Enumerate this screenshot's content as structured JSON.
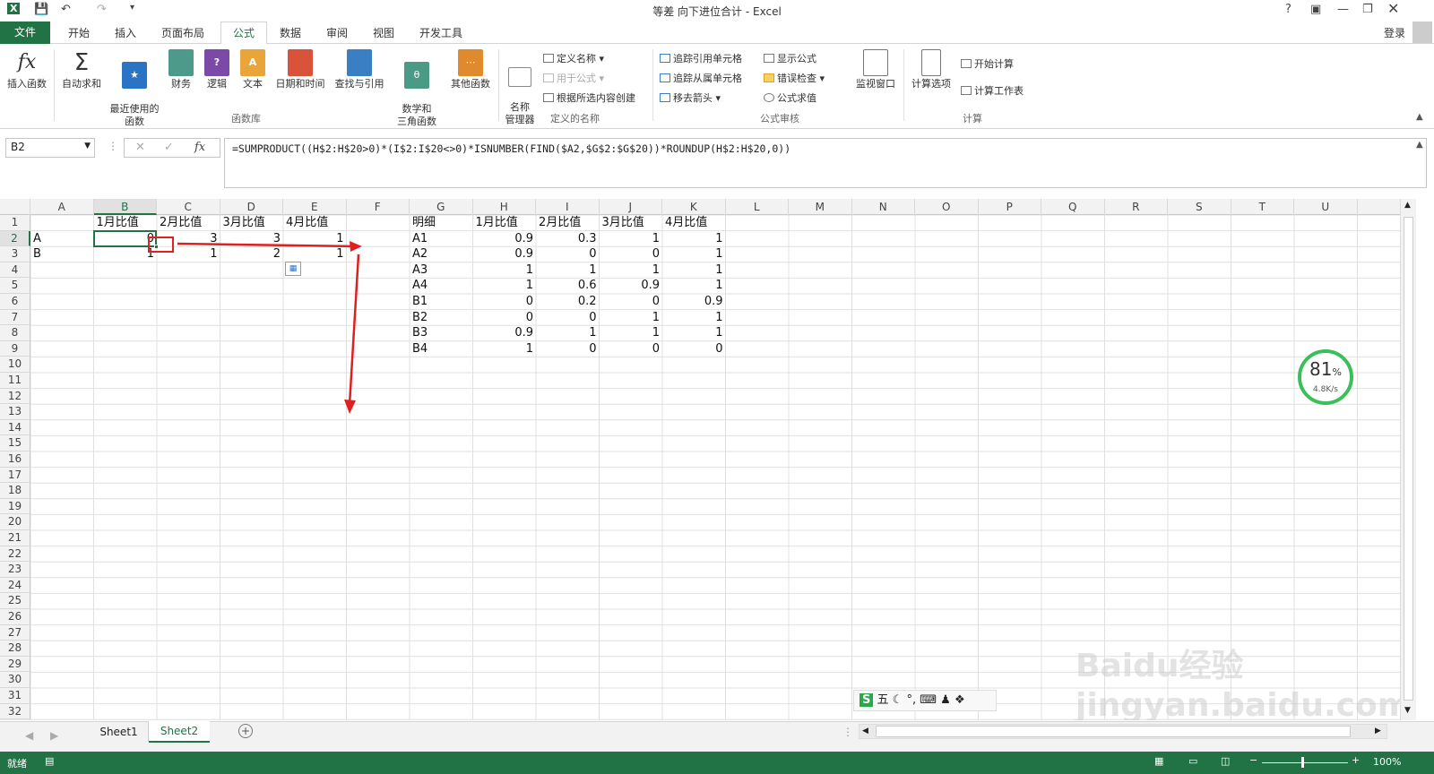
{
  "title": "等差 向下进位合计 - Excel",
  "signin": "登录",
  "tabs": [
    "文件",
    "开始",
    "插入",
    "页面布局",
    "公式",
    "数据",
    "审阅",
    "视图",
    "开发工具"
  ],
  "ribbon": {
    "func_lib": [
      "插入函数",
      "自动求和",
      "最近使用的\n函数",
      "财务",
      "逻辑",
      "文本",
      "日期和时间",
      "查找与引用",
      "数学和\n三角函数",
      "其他函数"
    ],
    "names": {
      "manager": "名称\n管理器",
      "define": "定义名称",
      "use": "用于公式",
      "create": "根据所选内容创建"
    },
    "audit": {
      "trace_pre": "追踪引用单元格",
      "trace_dep": "追踪从属单元格",
      "remove": "移去箭头",
      "show": "显示公式",
      "errcheck": "错误检查",
      "eval": "公式求值",
      "watch": "监视窗口"
    },
    "calc": {
      "options": "计算选项",
      "now": "开始计算",
      "sheet": "计算工作表"
    },
    "groups": [
      "函数库",
      "定义的名称",
      "公式审核",
      "计算"
    ]
  },
  "namebox": "B2",
  "formula": "=SUMPRODUCT((H$2:H$20>0)*(I$2:I$20<>0)*ISNUMBER(FIND($A2,$G$2:$G$20))*ROUNDUP(H$2:H$20,0))",
  "columns": [
    "A",
    "B",
    "C",
    "D",
    "E",
    "F",
    "G",
    "H",
    "I",
    "J",
    "K",
    "L",
    "M",
    "N",
    "O",
    "P",
    "Q",
    "R",
    "S",
    "T",
    "U"
  ],
  "left_table": {
    "header": [
      "1月比值",
      "2月比值",
      "3月比值",
      "4月比值"
    ],
    "rows": [
      {
        "name": "A",
        "v": [
          "0",
          "3",
          "3",
          "1"
        ]
      },
      {
        "name": "B",
        "v": [
          "1",
          "1",
          "2",
          "1"
        ]
      }
    ]
  },
  "right_table": {
    "header": [
      "明细",
      "1月比值",
      "2月比值",
      "3月比值",
      "4月比值"
    ],
    "rows": [
      [
        "A1",
        "0.9",
        "0.3",
        "1",
        "1"
      ],
      [
        "A2",
        "0.9",
        "0",
        "0",
        "1"
      ],
      [
        "A3",
        "1",
        "1",
        "1",
        "1"
      ],
      [
        "A4",
        "1",
        "0.6",
        "0.9",
        "1"
      ],
      [
        "B1",
        "0",
        "0.2",
        "0",
        "0.9"
      ],
      [
        "B2",
        "0",
        "0",
        "1",
        "1"
      ],
      [
        "B3",
        "0.9",
        "1",
        "1",
        "1"
      ],
      [
        "B4",
        "1",
        "0",
        "0",
        "0"
      ]
    ]
  },
  "sheets": [
    "Sheet1",
    "Sheet2"
  ],
  "status": "就绪",
  "zoom": "100%",
  "net": {
    "percent": "81",
    "unit": "%",
    "speed": "4.8K/s"
  },
  "ime": [
    "五"
  ],
  "watermark": "Baidu经验 jingyan.baidu.com"
}
